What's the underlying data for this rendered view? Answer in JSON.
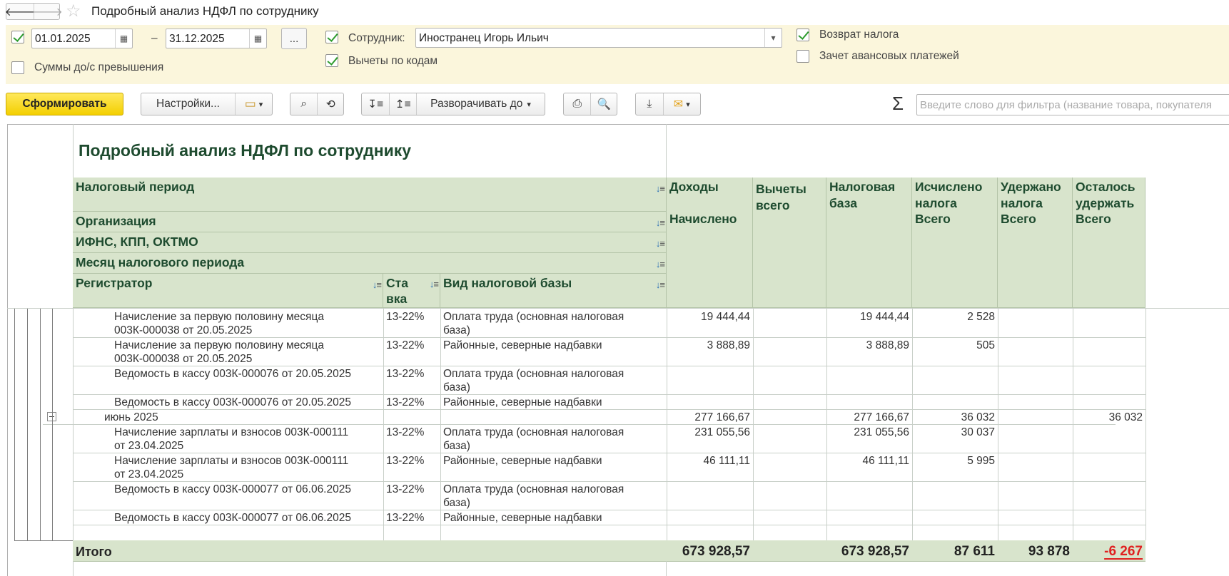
{
  "window": {
    "title": "Подробный анализ НДФЛ по сотруднику",
    "back_glyph": "🡐",
    "forward_glyph": "🡒",
    "star_glyph": "☆"
  },
  "settings": {
    "period_enabled": true,
    "date_from": "01.01.2025",
    "dash": "–",
    "date_to": "31.12.2025",
    "dots_label": "...",
    "sums_label": "Суммы до/с превышения",
    "sums_checked": false,
    "employee_checked": true,
    "employee_label": "Сотрудник:",
    "employee_value": "Иностранец Игорь Ильич",
    "deductions_checked": true,
    "deductions_label": "Вычеты по кодам",
    "tax_refund_checked": true,
    "tax_refund_label": "Возврат налога",
    "advance_offset_checked": false,
    "advance_offset_label": "Зачет авансовых платежей"
  },
  "toolbar": {
    "generate_label": "Сформировать",
    "settings_label": "Настройки...",
    "expand_label": "Разворачивать до",
    "search_placeholder": "Введите слово для фильтра (название товара, покупателя",
    "sigma": "Σ"
  },
  "report": {
    "title": "Подробный анализ НДФЛ по сотруднику",
    "headers": {
      "tax_period": "Налоговый период",
      "organization": "Организация",
      "ifns": "ИФНС, КПП, ОКТМО",
      "month": "Месяц налогового периода",
      "registrar": "Регистратор",
      "rate": "Ста вка",
      "base_type": "Вид налоговой базы",
      "income": "Доходы",
      "income_sub": "Начислено",
      "deductions": "Вычеты всего",
      "tax_base": "Налоговая база",
      "calculated": "Исчислено налога",
      "calculated_sub": "Всего",
      "withheld": "Удержано налога",
      "withheld_sub": "Всего",
      "remaining": "Осталось удержать",
      "remaining_sub": "Всего"
    },
    "rows": [
      {
        "registrar": [
          "Начисление за первую половину месяца",
          "003К-000038 от 20.05.2025"
        ],
        "rate": "13-22%",
        "base": [
          "Оплата труда (основная налоговая",
          "база)"
        ],
        "income": "19 444,44",
        "deductions": "",
        "tax_base": "19 444,44",
        "calculated": "2 528",
        "withheld": "",
        "remaining": ""
      },
      {
        "registrar": [
          "Начисление за первую половину месяца",
          "003К-000038 от 20.05.2025"
        ],
        "rate": "13-22%",
        "base": [
          "Районные, северные надбавки",
          ""
        ],
        "income": "3 888,89",
        "deductions": "",
        "tax_base": "3 888,89",
        "calculated": "505",
        "withheld": "",
        "remaining": ""
      },
      {
        "registrar": [
          "Ведомость в кассу 003К-000076 от 20.05.2025",
          ""
        ],
        "rate": "13-22%",
        "base": [
          "Оплата труда (основная налоговая",
          "база)"
        ],
        "income": "",
        "deductions": "",
        "tax_base": "",
        "calculated": "",
        "withheld": "",
        "remaining": ""
      },
      {
        "registrar": [
          "Ведомость в кассу 003К-000076 от 20.05.2025"
        ],
        "rate": "13-22%",
        "base": [
          "Районные, северные надбавки"
        ],
        "income": "",
        "deductions": "",
        "tax_base": "",
        "calculated": "",
        "withheld": "",
        "remaining": ""
      },
      {
        "group": true,
        "registrar": [
          "июнь 2025"
        ],
        "rate": "",
        "base": [
          ""
        ],
        "income": "277 166,67",
        "deductions": "",
        "tax_base": "277 166,67",
        "calculated": "36 032",
        "withheld": "",
        "remaining": "36 032"
      },
      {
        "registrar": [
          "Начисление зарплаты и взносов 003К-000111",
          "от 23.04.2025"
        ],
        "rate": "13-22%",
        "base": [
          "Оплата труда (основная налоговая",
          "база)"
        ],
        "income": "231 055,56",
        "deductions": "",
        "tax_base": "231 055,56",
        "calculated": "30 037",
        "withheld": "",
        "remaining": ""
      },
      {
        "registrar": [
          "Начисление зарплаты и взносов 003К-000111",
          "от 23.04.2025"
        ],
        "rate": "13-22%",
        "base": [
          "Районные, северные надбавки",
          ""
        ],
        "income": "46 111,11",
        "deductions": "",
        "tax_base": "46 111,11",
        "calculated": "5 995",
        "withheld": "",
        "remaining": ""
      },
      {
        "registrar": [
          "Ведомость в кассу 003К-000077 от 06.06.2025",
          ""
        ],
        "rate": "13-22%",
        "base": [
          "Оплата труда (основная налоговая",
          "база)"
        ],
        "income": "",
        "deductions": "",
        "tax_base": "",
        "calculated": "",
        "withheld": "",
        "remaining": ""
      },
      {
        "registrar": [
          "Ведомость в кассу 003К-000077 от 06.06.2025"
        ],
        "rate": "13-22%",
        "base": [
          "Районные, северные надбавки"
        ],
        "income": "",
        "deductions": "",
        "tax_base": "",
        "calculated": "",
        "withheld": "",
        "remaining": ""
      }
    ],
    "total": {
      "label": "Итого",
      "income": "673 928,57",
      "deductions": "",
      "tax_base": "673 928,57",
      "calculated": "87 611",
      "withheld": "93 878",
      "remaining": "-6 267"
    }
  },
  "colors": {
    "header_bg": "#d8e4cc",
    "header_text": "#1e4b2f",
    "panel_bg": "#fbf6dc",
    "generate_bg": "#f3cf00",
    "negative": "#e02020"
  }
}
